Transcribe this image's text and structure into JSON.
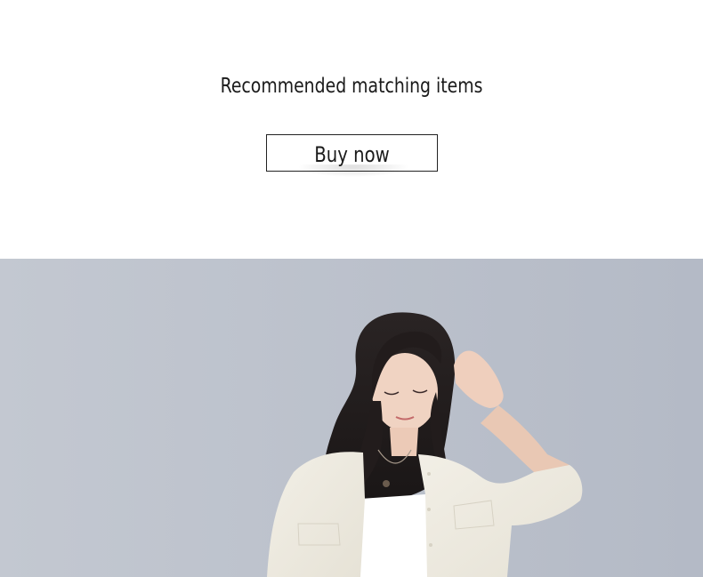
{
  "recommend": {
    "title": "Recommended matching items",
    "buy_label": "Buy now"
  },
  "hero": {
    "subject": "model-photo"
  }
}
